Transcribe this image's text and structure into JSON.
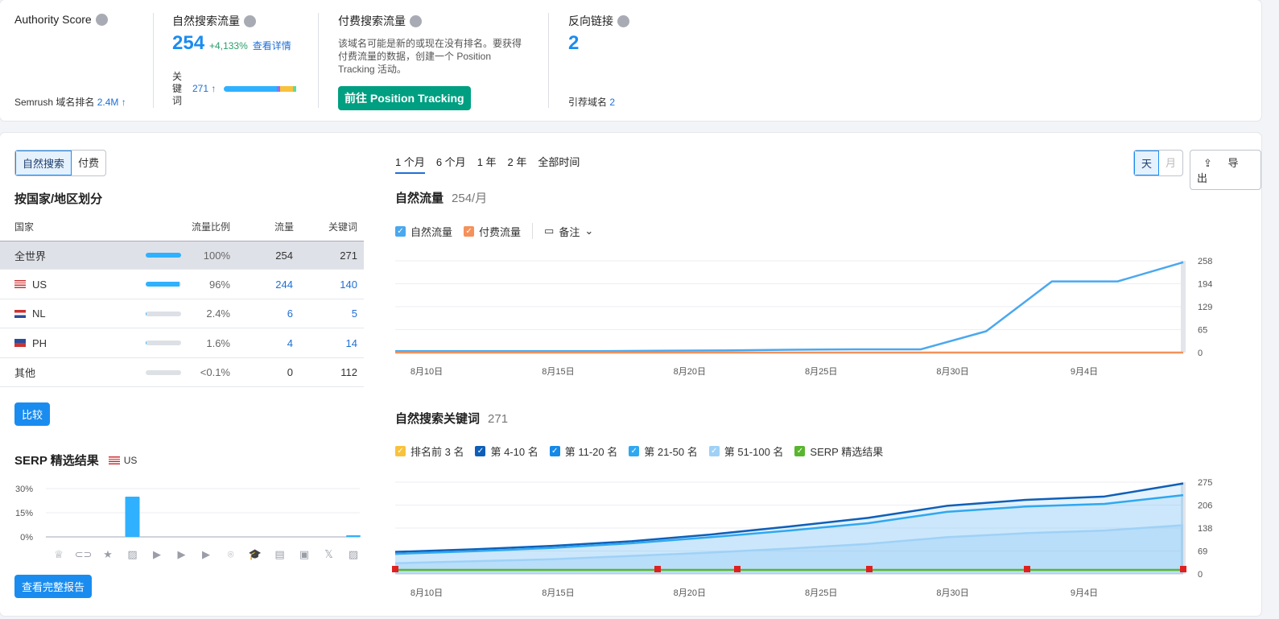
{
  "kpis": {
    "authority": {
      "title": "Authority Score",
      "rank_label": "Semrush 域名排名",
      "rank_value": "2.4M ↑"
    },
    "organic": {
      "title": "自然搜索流量",
      "value": "254",
      "change": "+4,133%",
      "details_link": "查看详情",
      "keywords_label": "关键词",
      "keywords_value": "271 ↑"
    },
    "paid": {
      "title": "付费搜索流量",
      "message": "该域名可能是新的或现在没有排名。要获得付费流量的数据，创建一个 Position Tracking 活动。",
      "button": "前往 Position Tracking"
    },
    "backlinks": {
      "title": "反向链接",
      "value": "2",
      "ref_domains_label": "引荐域名",
      "ref_domains_value": "2"
    }
  },
  "left": {
    "toggle": [
      "自然搜索",
      "付费"
    ],
    "country_title": "按国家/地区划分",
    "columns": [
      "国家",
      "流量比例",
      "流量",
      "关键词"
    ],
    "rows": [
      {
        "country": "全世界",
        "share": "100%",
        "share_value": 100,
        "traffic": "254",
        "keywords": "271"
      },
      {
        "country": "US",
        "share": "96%",
        "share_value": 96,
        "traffic": "244",
        "keywords": "140"
      },
      {
        "country": "NL",
        "share": "2.4%",
        "share_value": 2.4,
        "traffic": "6",
        "keywords": "5"
      },
      {
        "country": "PH",
        "share": "1.6%",
        "share_value": 1.6,
        "traffic": "4",
        "keywords": "14"
      },
      {
        "country": "其他",
        "share": "<0.1%",
        "share_value": 0.1,
        "traffic": "0",
        "keywords": "112"
      }
    ],
    "compare_button": "比较",
    "serp_title": "SERP 精选结果",
    "serp_country": "US",
    "full_report_button": "查看完整报告"
  },
  "right": {
    "periods": [
      "1 个月",
      "6 个月",
      "1 年",
      "2 年",
      "全部时间"
    ],
    "granularity": [
      "天",
      "月"
    ],
    "export_button": "导出",
    "traffic_title": "自然流量",
    "traffic_value": "254/月",
    "traffic_legend": [
      "自然流量",
      "付费流量"
    ],
    "notes_label": "备注",
    "keywords_title": "自然搜索关键词",
    "keywords_value": "271",
    "keywords_legend": [
      "排名前 3 名",
      "第 4-10 名",
      "第 11-20 名",
      "第 21-50 名",
      "第 51-100 名",
      "SERP 精选结果"
    ]
  },
  "colors": {
    "accent": "#1a8cf0",
    "green_btn": "#009f81",
    "organic": "#4aa8ef",
    "paid": "#f5915b",
    "top3": "#f9c23c",
    "pos4_10": "#0f5fb8",
    "pos11_20": "#1589e8",
    "pos21_50": "#2fa8f0",
    "pos51_100": "#9fd1f7",
    "serp": "#5ab52e"
  },
  "chart_data": [
    {
      "type": "bar",
      "title": "SERP 精选结果",
      "categories": [
        "featured-snippet",
        "sitelinks",
        "reviews",
        "image",
        "video",
        "featured-video",
        "video-carousel",
        "local-pack",
        "knowledge",
        "news",
        "jobs",
        "twitter",
        "image-pack"
      ],
      "values": [
        0,
        0,
        0,
        25,
        0,
        0,
        0,
        0,
        0,
        0,
        0,
        0,
        1
      ],
      "yticks": [
        "0%",
        "15%",
        "30%"
      ],
      "ylim": [
        0,
        30
      ]
    },
    {
      "type": "line",
      "title": "自然流量",
      "x": [
        "8月9日",
        "8月12日",
        "8月15日",
        "8月18日",
        "8月21日",
        "8月24日",
        "8月27日",
        "8月30日",
        "9月2日",
        "9月3日",
        "9月4日",
        "9月7日",
        "9月8日"
      ],
      "series": [
        {
          "name": "自然流量",
          "values": [
            4,
            4,
            4,
            4,
            5,
            6,
            8,
            9,
            9,
            60,
            200,
            200,
            254
          ]
        },
        {
          "name": "付费流量",
          "values": [
            0,
            0,
            0,
            0,
            0,
            0,
            0,
            0,
            0,
            0,
            0,
            0,
            0
          ]
        }
      ],
      "xticks": [
        "8月10日",
        "8月15日",
        "8月20日",
        "8月25日",
        "8月30日",
        "9月4日"
      ],
      "yticks": [
        "0",
        "65",
        "129",
        "194",
        "258"
      ],
      "ylim": [
        0,
        258
      ]
    },
    {
      "type": "area",
      "title": "自然搜索关键词",
      "x": [
        "8月9日",
        "8月12日",
        "8月15日",
        "8月18日",
        "8月21日",
        "8月24日",
        "8月27日",
        "8月30日",
        "9月2日",
        "9月5日",
        "9月8日"
      ],
      "series": [
        {
          "name": "第 4-10 名",
          "values": [
            66,
            74,
            84,
            98,
            118,
            142,
            168,
            204,
            222,
            232,
            271
          ]
        },
        {
          "name": "第 21-50 名",
          "values": [
            60,
            68,
            78,
            92,
            110,
            130,
            152,
            186,
            202,
            210,
            236
          ]
        },
        {
          "name": "第 51-100 名",
          "values": [
            32,
            38,
            44,
            54,
            64,
            76,
            90,
            110,
            122,
            130,
            146
          ]
        }
      ],
      "xticks": [
        "8月10日",
        "8月15日",
        "8月20日",
        "8月25日",
        "8月30日",
        "9月4日"
      ],
      "yticks": [
        "0",
        "69",
        "138",
        "206",
        "275"
      ],
      "ylim": [
        0,
        275
      ]
    }
  ]
}
